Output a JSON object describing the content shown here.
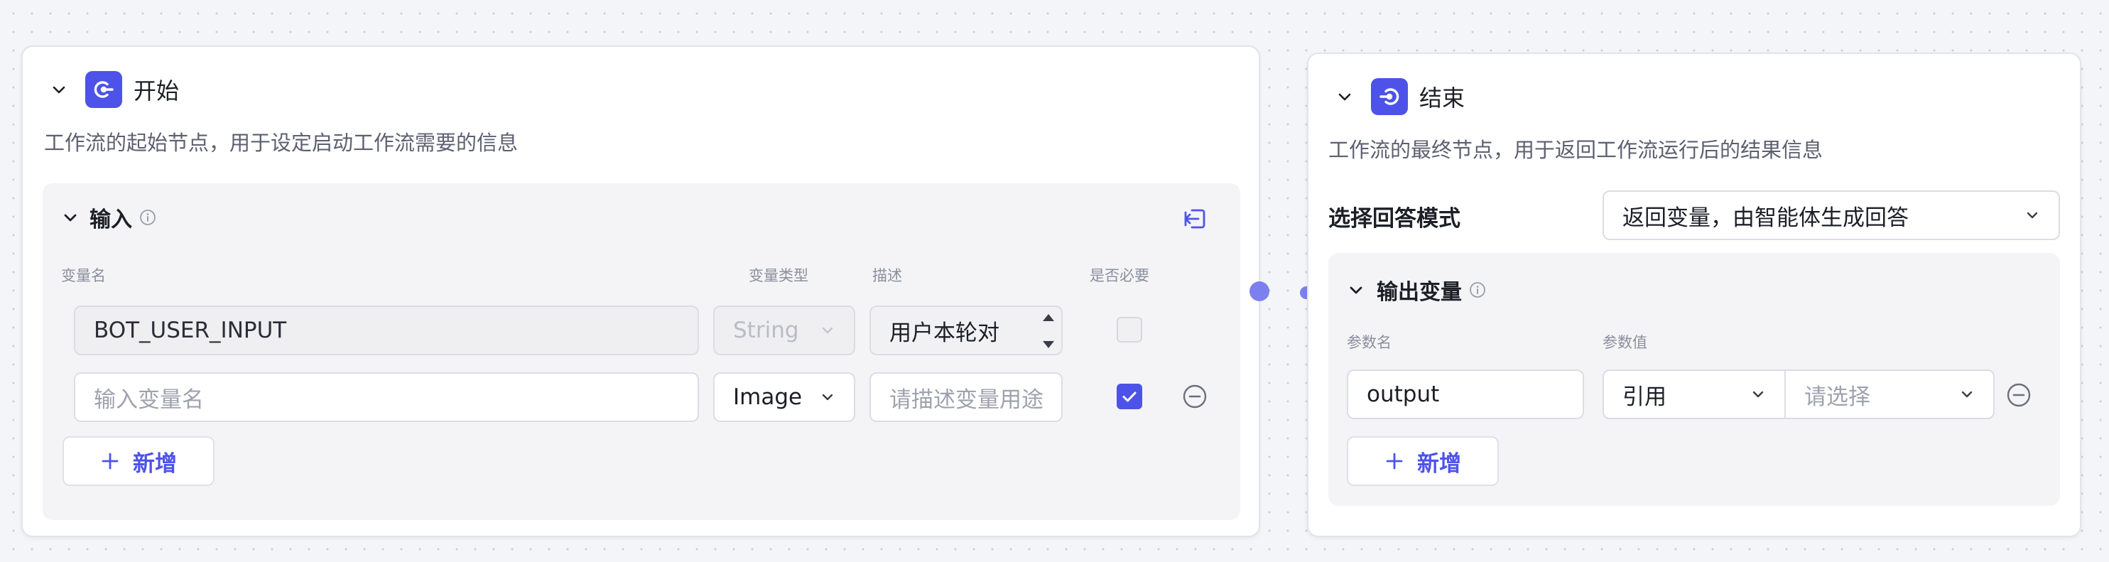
{
  "start_node": {
    "title": "开始",
    "description": "工作流的起始节点，用于设定启动工作流需要的信息",
    "input_section": {
      "title": "输入",
      "columns": {
        "name": "变量名",
        "type": "变量类型",
        "description": "描述",
        "required": "是否必要"
      },
      "rows": [
        {
          "name": "BOT_USER_INPUT",
          "type": "String",
          "description": "用户本轮对",
          "required": false
        },
        {
          "name_placeholder": "输入变量名",
          "type": "Image",
          "description_placeholder": "请描述变量用途",
          "required": true
        }
      ],
      "add_label": "新增"
    }
  },
  "end_node": {
    "title": "结束",
    "description": "工作流的最终节点，用于返回工作流运行后的结果信息",
    "mode_label": "选择回答模式",
    "mode_value": "返回变量，由智能体生成回答",
    "output_section": {
      "title": "输出变量",
      "columns": {
        "param_name": "参数名",
        "param_value": "参数值"
      },
      "rows": [
        {
          "name": "output",
          "value_source": "引用",
          "value_placeholder": "请选择"
        }
      ],
      "add_label": "新增"
    }
  },
  "colors": {
    "accent": "#4d53e8",
    "port": "#7c80ef",
    "canvas_bg": "#f4f5f8"
  },
  "icons": {
    "collapse": "chevron-down-icon",
    "start": "start-node-icon",
    "end": "end-node-icon",
    "info": "info-icon",
    "input_collapse": "collapse-panel-icon",
    "remove": "minus-circle-icon",
    "add": "plus-icon"
  }
}
